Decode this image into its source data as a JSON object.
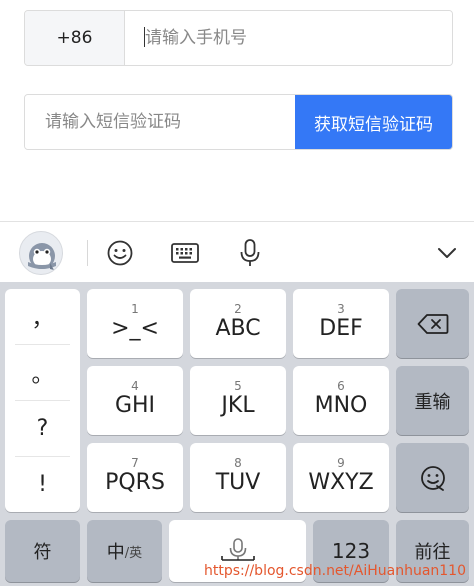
{
  "form": {
    "country_code": "+86",
    "phone_placeholder": "请输入手机号",
    "sms_placeholder": "请输入短信验证码",
    "get_code_label": "获取短信验证码",
    "accent_color": "#3478f6"
  },
  "toolbar": {
    "icons": [
      "mascot-avatar-icon",
      "emoji-icon",
      "keyboard-icon",
      "microphone-icon",
      "chevron-down-icon"
    ]
  },
  "keyboard": {
    "punctuation": [
      "，",
      "。",
      "?",
      "!"
    ],
    "keys": [
      {
        "num": "1",
        "letters": ">_<"
      },
      {
        "num": "2",
        "letters": "ABC"
      },
      {
        "num": "3",
        "letters": "DEF"
      },
      {
        "num": "4",
        "letters": "GHI"
      },
      {
        "num": "5",
        "letters": "JKL"
      },
      {
        "num": "6",
        "letters": "MNO"
      },
      {
        "num": "7",
        "letters": "PQRS"
      },
      {
        "num": "8",
        "letters": "TUV"
      },
      {
        "num": "9",
        "letters": "WXYZ"
      }
    ],
    "retype_label": "重输",
    "symbols_label": "符",
    "lang_main": "中",
    "lang_sub": "/英",
    "numbers_label": "123",
    "next_label": "前往"
  },
  "watermark": "https://blog.csdn.net/AiHuanhuan110"
}
